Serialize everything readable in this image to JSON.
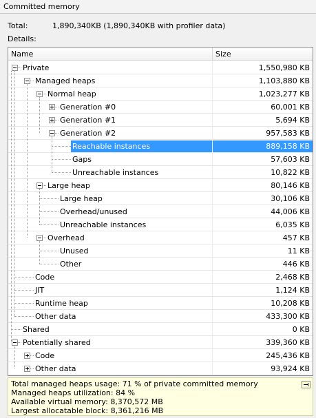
{
  "panel_title": "Committed memory",
  "summary": {
    "label": "Total:",
    "value": "1,890,340KB (1,890,340KB with profiler data)"
  },
  "details_label": "Details:",
  "columns": {
    "name": "Name",
    "size": "Size"
  },
  "rows": [
    {
      "name": "Private",
      "size": "1,550,980 KB",
      "depth": 0,
      "toggle": "minus"
    },
    {
      "name": "Managed heaps",
      "size": "1,103,880 KB",
      "depth": 1,
      "toggle": "minus"
    },
    {
      "name": "Normal heap",
      "size": "1,023,277 KB",
      "depth": 2,
      "toggle": "minus"
    },
    {
      "name": "Generation #0",
      "size": "60,001 KB",
      "depth": 3,
      "toggle": "plus"
    },
    {
      "name": "Generation #1",
      "size": "5,694 KB",
      "depth": 3,
      "toggle": "plus"
    },
    {
      "name": "Generation #2",
      "size": "957,583 KB",
      "depth": 3,
      "toggle": "minus"
    },
    {
      "name": "Reachable instances",
      "size": "889,158 KB",
      "depth": 4,
      "toggle": "none",
      "selected": true
    },
    {
      "name": "Gaps",
      "size": "57,603 KB",
      "depth": 4,
      "toggle": "none"
    },
    {
      "name": "Unreachable instances",
      "size": "10,822 KB",
      "depth": 4,
      "toggle": "none"
    },
    {
      "name": "Large heap",
      "size": "80,146 KB",
      "depth": 2,
      "toggle": "minus"
    },
    {
      "name": "Large heap",
      "size": "30,106 KB",
      "depth": 3,
      "toggle": "none"
    },
    {
      "name": "Overhead/unused",
      "size": "44,006 KB",
      "depth": 3,
      "toggle": "none"
    },
    {
      "name": "Unreachable instances",
      "size": "6,035 KB",
      "depth": 3,
      "toggle": "none"
    },
    {
      "name": "Overhead",
      "size": "457 KB",
      "depth": 2,
      "toggle": "minus"
    },
    {
      "name": "Unused",
      "size": "11 KB",
      "depth": 3,
      "toggle": "none"
    },
    {
      "name": "Other",
      "size": "446 KB",
      "depth": 3,
      "toggle": "none"
    },
    {
      "name": "Code",
      "size": "2,468 KB",
      "depth": 1,
      "toggle": "none"
    },
    {
      "name": "JIT",
      "size": "1,124 KB",
      "depth": 1,
      "toggle": "none"
    },
    {
      "name": "Runtime heap",
      "size": "10,208 KB",
      "depth": 1,
      "toggle": "none"
    },
    {
      "name": "Other data",
      "size": "433,300 KB",
      "depth": 1,
      "toggle": "none"
    },
    {
      "name": "Shared",
      "size": "0 KB",
      "depth": 0,
      "toggle": "none"
    },
    {
      "name": "Potentially shared",
      "size": "339,360 KB",
      "depth": 0,
      "toggle": "minus"
    },
    {
      "name": "Code",
      "size": "245,436 KB",
      "depth": 1,
      "toggle": "plus"
    },
    {
      "name": "Other data",
      "size": "93,924 KB",
      "depth": 1,
      "toggle": "plus"
    }
  ],
  "footer": {
    "line1": "Total managed heaps usage: 71 % of private committed memory",
    "line2": "Managed heaps utilization: 84 %",
    "line3": "Available virtual memory: 8,370,572 MB",
    "line4": "Largest allocatable block: 8,361,216 MB"
  }
}
